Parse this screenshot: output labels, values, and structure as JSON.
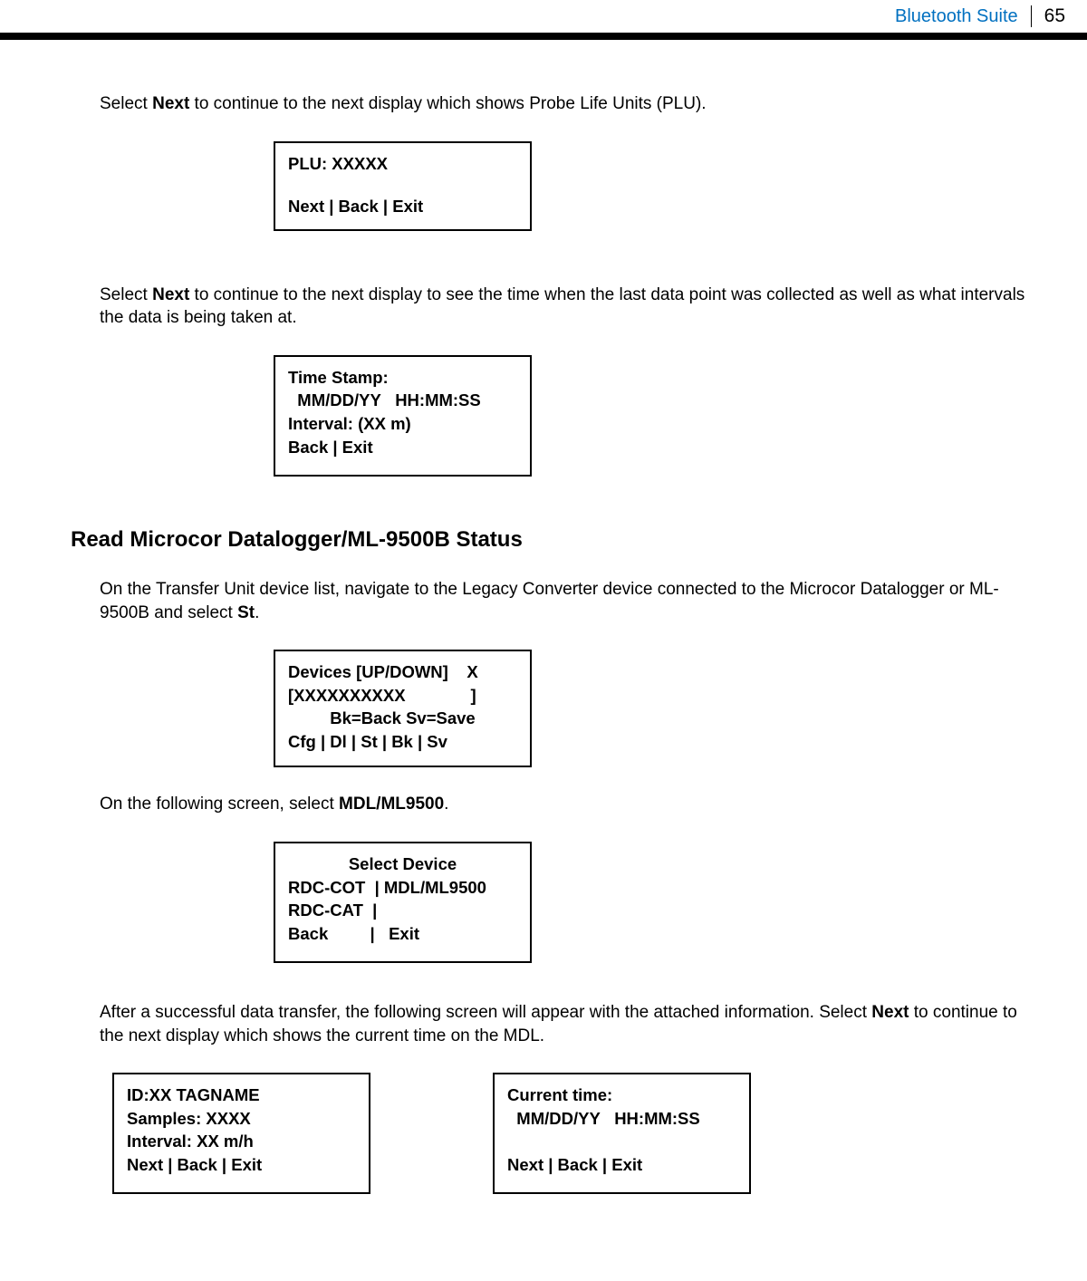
{
  "header": {
    "title": "Bluetooth Suite",
    "page_number": "65"
  },
  "para1_pre": "Select ",
  "para1_bold": "Next",
  "para1_post": " to continue to the next display which shows Probe Life Units (PLU).",
  "screen1": {
    "line1": "PLU: XXXXX",
    "line2": "Next   |   Back   |   Exit"
  },
  "para2_pre": "Select ",
  "para2_bold": "Next",
  "para2_post": " to continue to the next display to see the time when the last data point was collected as well as what intervals the data is being taken at.",
  "screen2": {
    "line1": "Time Stamp:",
    "line2": "  MM/DD/YY   HH:MM:SS",
    "line3": "Interval: (XX m)",
    "line4": "Back   |   Exit"
  },
  "heading": "Read Microcor Datalogger/ML-9500B Status",
  "para3_pre": "On the Transfer Unit device list, navigate to the Legacy Converter device connected to the Microcor Datalogger or ML-9500B and select ",
  "para3_bold": "St",
  "para3_post": ".",
  "screen3": {
    "line1": "Devices [UP/DOWN]    X",
    "line2": "[XXXXXXXXXX              ]",
    "line3": "Bk=Back  Sv=Save",
    "line4": "Cfg  |  Dl  |  St  |  Bk  |  Sv"
  },
  "para4_pre": "On the following screen, select ",
  "para4_bold": "MDL/ML9500",
  "para4_post": ".",
  "screen4": {
    "line1": "Select Device",
    "line2": "RDC-COT  | MDL/ML9500",
    "line3": "RDC-CAT  |",
    "line4": "Back         |   Exit"
  },
  "para5_pre": "After a successful data transfer, the following screen will appear with the attached information. Select ",
  "para5_bold": "Next",
  "para5_post": " to continue to the next display which shows the current time on the MDL.",
  "screen5a": {
    "line1": "ID:XX  TAGNAME",
    "line2": "Samples: XXXX",
    "line3": "Interval: XX m/h",
    "line4": "Next   |   Back   |   Exit"
  },
  "screen5b": {
    "line1": "Current time:",
    "line2": "  MM/DD/YY   HH:MM:SS",
    "line3": " ",
    "line4": "Next   |   Back   |   Exit"
  }
}
